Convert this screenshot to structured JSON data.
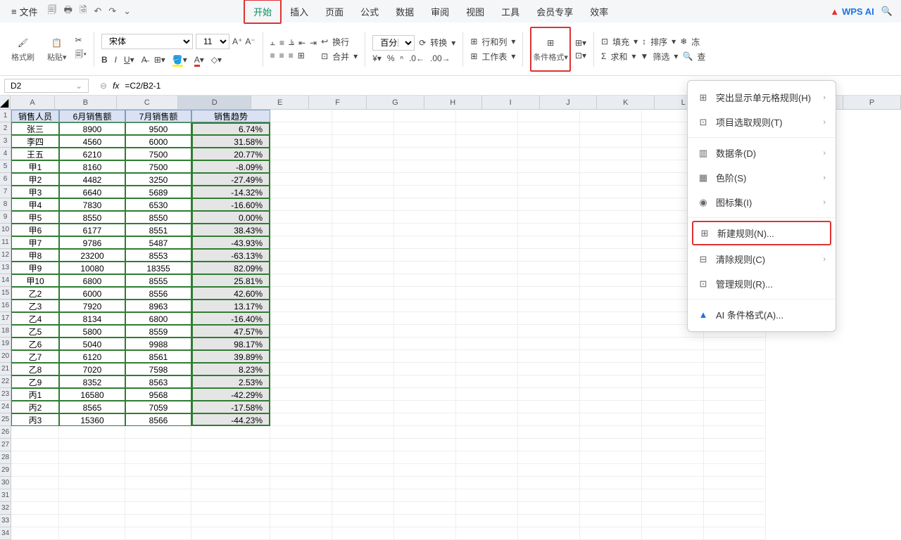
{
  "menu": {
    "file": "文件",
    "tabs": [
      "开始",
      "插入",
      "页面",
      "公式",
      "数据",
      "审阅",
      "视图",
      "工具",
      "会员专享",
      "效率"
    ],
    "active_tab": "开始",
    "wps_ai": "WPS AI"
  },
  "ribbon": {
    "format_painter": "格式刷",
    "paste": "粘贴",
    "font_name": "宋体",
    "font_size": "11",
    "wrap": "换行",
    "merge": "合并",
    "percent": "百分比",
    "convert": "转换",
    "rowcol": "行和列",
    "sheet": "工作表",
    "cond_format": "条件格式",
    "fill": "填充",
    "sort": "排序",
    "freeze": "冻",
    "sum": "求和",
    "filter": "筛选",
    "find": "查"
  },
  "formula_bar": {
    "name_box": "D2",
    "formula": "=C2/B2-1"
  },
  "columns": [
    "A",
    "B",
    "C",
    "D",
    "E",
    "F",
    "G",
    "H",
    "I",
    "J",
    "K",
    "L",
    "P"
  ],
  "headers": [
    "销售人员",
    "6月销售额",
    "7月销售额",
    "销售趋势"
  ],
  "rows": [
    {
      "a": "张三",
      "b": "8900",
      "c": "9500",
      "d": "6.74%"
    },
    {
      "a": "李四",
      "b": "4560",
      "c": "6000",
      "d": "31.58%"
    },
    {
      "a": "王五",
      "b": "6210",
      "c": "7500",
      "d": "20.77%"
    },
    {
      "a": "甲1",
      "b": "8160",
      "c": "7500",
      "d": "-8.09%"
    },
    {
      "a": "甲2",
      "b": "4482",
      "c": "3250",
      "d": "-27.49%"
    },
    {
      "a": "甲3",
      "b": "6640",
      "c": "5689",
      "d": "-14.32%"
    },
    {
      "a": "甲4",
      "b": "7830",
      "c": "6530",
      "d": "-16.60%"
    },
    {
      "a": "甲5",
      "b": "8550",
      "c": "8550",
      "d": "0.00%"
    },
    {
      "a": "甲6",
      "b": "6177",
      "c": "8551",
      "d": "38.43%"
    },
    {
      "a": "甲7",
      "b": "9786",
      "c": "5487",
      "d": "-43.93%"
    },
    {
      "a": "甲8",
      "b": "23200",
      "c": "8553",
      "d": "-63.13%"
    },
    {
      "a": "甲9",
      "b": "10080",
      "c": "18355",
      "d": "82.09%"
    },
    {
      "a": "甲10",
      "b": "6800",
      "c": "8555",
      "d": "25.81%"
    },
    {
      "a": "乙2",
      "b": "6000",
      "c": "8556",
      "d": "42.60%"
    },
    {
      "a": "乙3",
      "b": "7920",
      "c": "8963",
      "d": "13.17%"
    },
    {
      "a": "乙4",
      "b": "8134",
      "c": "6800",
      "d": "-16.40%"
    },
    {
      "a": "乙5",
      "b": "5800",
      "c": "8559",
      "d": "47.57%"
    },
    {
      "a": "乙6",
      "b": "5040",
      "c": "9988",
      "d": "98.17%"
    },
    {
      "a": "乙7",
      "b": "6120",
      "c": "8561",
      "d": "39.89%"
    },
    {
      "a": "乙8",
      "b": "7020",
      "c": "7598",
      "d": "8.23%"
    },
    {
      "a": "乙9",
      "b": "8352",
      "c": "8563",
      "d": "2.53%"
    },
    {
      "a": "丙1",
      "b": "16580",
      "c": "9568",
      "d": "-42.29%"
    },
    {
      "a": "丙2",
      "b": "8565",
      "c": "7059",
      "d": "-17.58%"
    },
    {
      "a": "丙3",
      "b": "15360",
      "c": "8566",
      "d": "-44.23%"
    }
  ],
  "dropdown": {
    "highlight_rules": "突出显示单元格规则(H)",
    "top_bottom": "项目选取规则(T)",
    "data_bars": "数据条(D)",
    "color_scales": "色阶(S)",
    "icon_sets": "图标集(I)",
    "new_rule": "新建规则(N)...",
    "clear_rules": "清除规则(C)",
    "manage_rules": "管理规则(R)...",
    "ai_cf": "AI 条件格式(A)..."
  }
}
